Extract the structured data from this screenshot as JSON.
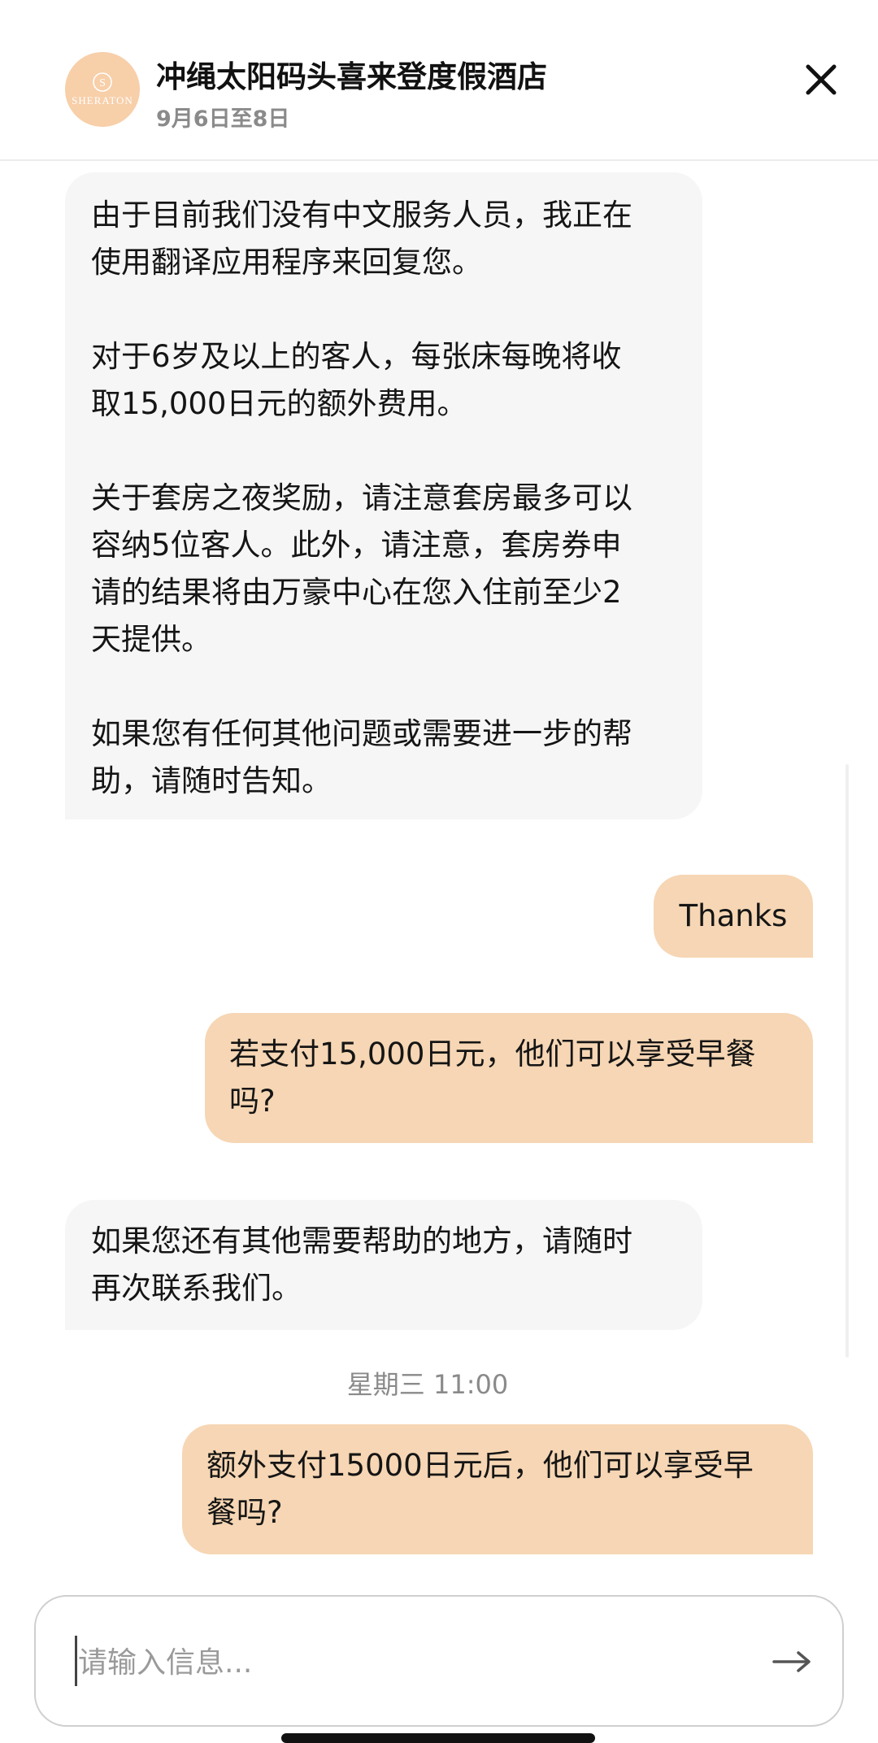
{
  "header": {
    "hotel_name": "冲绳太阳码头喜来登度假酒店",
    "dates": "9月6日至8日",
    "logo_text": "SHERATON",
    "logo_color": "#f7cfa9",
    "close_icon": "close-icon"
  },
  "messages": [
    {
      "direction": "incoming",
      "paragraphs": [
        "由于目前我们没有中文服务人员，我正在\n使用翻译应用程序来回复您。",
        "对于6岁及以上的客人，每张床每晚将收\n取15,000日元的额外费用。",
        "关于套房之夜奖励，请注意套房最多可以\n容纳5位客人。此外，请注意，套房券申\n请的结果将由万豪中心在您入住前至少2\n天提供。",
        "如果您有任何其他问题或需要进一步的帮\n助，请随时告知。"
      ]
    },
    {
      "direction": "outgoing",
      "paragraphs": [
        "Thanks"
      ]
    },
    {
      "direction": "outgoing",
      "paragraphs": [
        "若支付15,000日元，他们可以享受早餐\n吗?"
      ]
    },
    {
      "direction": "incoming",
      "paragraphs": [
        "如果您还有其他需要帮助的地方，请随时\n再次联系我们。"
      ]
    },
    {
      "direction": "outgoing",
      "paragraphs": [
        "额外支付15000日元后，他们可以享受早\n餐吗?"
      ]
    }
  ],
  "timestamp": "星期三 11:00",
  "input": {
    "placeholder": "请输入信息...",
    "value": "",
    "send_icon": "arrow-right-icon"
  },
  "colors": {
    "incoming_bubble": "#f6f6f6",
    "outgoing_bubble": "#f6d6b4",
    "muted_text": "#8a8a8a"
  }
}
